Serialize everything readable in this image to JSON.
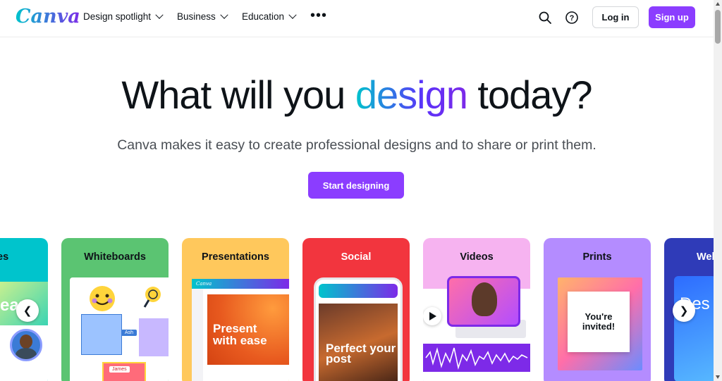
{
  "nav": {
    "logo": "Canva",
    "menu": [
      {
        "label": "Design spotlight"
      },
      {
        "label": "Business"
      },
      {
        "label": "Education"
      }
    ],
    "more_icon": "more-horizontal-icon",
    "search_icon": "search-icon",
    "help_icon": "help-icon",
    "login_label": "Log in",
    "signup_label": "Sign up"
  },
  "hero": {
    "title_before": "What will you ",
    "title_highlight": "design",
    "title_after": " today?",
    "subtitle": "Canva makes it easy to create professional designs and to share or print them.",
    "cta_label": "Start designing"
  },
  "cards": [
    {
      "label": "es",
      "bg": "#00c4cc"
    },
    {
      "label": "Whiteboards",
      "bg": "#5bc472"
    },
    {
      "label": "Presentations",
      "bg": "#ffc85c"
    },
    {
      "label": "Social",
      "bg": "#f2353e"
    },
    {
      "label": "Videos",
      "bg": "#f6b3f0"
    },
    {
      "label": "Prints",
      "bg": "#b48cff"
    },
    {
      "label": "Web",
      "bg": "#2f3bb8"
    }
  ],
  "card_content": {
    "whiteboard_tag_1": "Ash",
    "whiteboard_tag_2": "James",
    "presentation_text": "Present with ease",
    "social_text": "Perfect your post",
    "prints_text": "You're invited!",
    "web_text": "Des",
    "es_text": "earn"
  },
  "carousel": {
    "prev_icon": "chevron-left-icon",
    "next_icon": "chevron-right-icon"
  },
  "colors": {
    "brand": "#8b3dff",
    "teal": "#00c4cc"
  }
}
